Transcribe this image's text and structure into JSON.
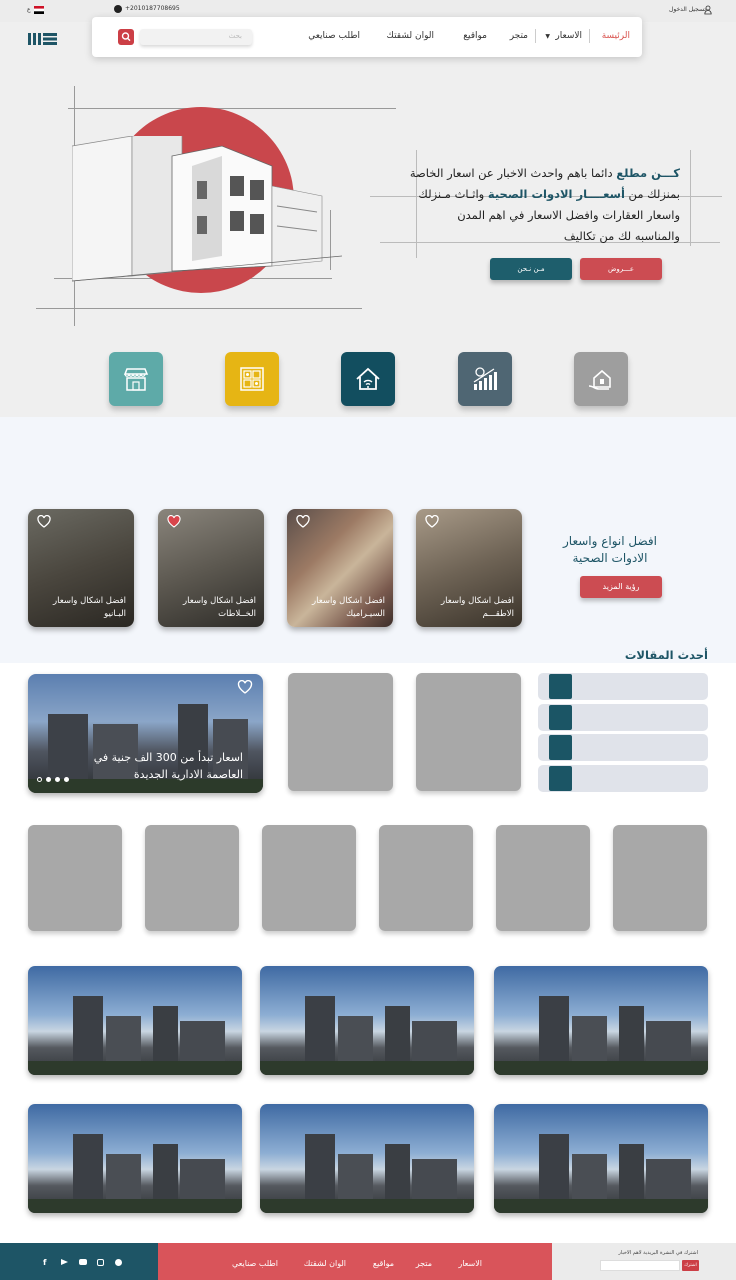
{
  "topbar": {
    "login_label": "تسجيل الدخول",
    "phone": "+2010187708695",
    "language": "ع"
  },
  "nav": {
    "items": [
      {
        "label": "الرئيسة",
        "active": true
      },
      {
        "label": "الاسعار",
        "dropdown": true
      },
      {
        "label": "متجر"
      },
      {
        "label": "مواقيع"
      },
      {
        "label": "الوان لشقتك"
      },
      {
        "label": "اطلب صنايعي"
      }
    ],
    "search_placeholder": "بحث"
  },
  "hero": {
    "line1_bold": "كـــن مطلع",
    "line1_rest": " دائما باهم واحدث الاخبار عن اسعار الخاصة",
    "line2_a": "بمنزلك من ",
    "line2_bold": "أسعــــار الادوات الصحية",
    "line2_b": " واثـاث مـنزلك",
    "line3": "واسعار العقارات وافضل الاسعار في اهم المدن",
    "line4": "والمناسبه لك من تكاليف",
    "btn_offers": "عـــروض",
    "btn_about": "مـن نـحن"
  },
  "categories": [
    {
      "icon": "house-hand-icon",
      "color": "#9e9e9e"
    },
    {
      "icon": "growth-chart-icon",
      "color": "#4f6673"
    },
    {
      "icon": "smart-home-icon",
      "color": "#124e5f"
    },
    {
      "icon": "tiles-icon",
      "color": "#e6b514"
    },
    {
      "icon": "store-icon",
      "color": "#5eaaa8"
    }
  ],
  "products": {
    "title_line1": "افضل انواع واسعار",
    "title_line2": "الادوات الصحية",
    "more_button": "رؤية المزيد",
    "items": [
      {
        "line1": "افضل اشكال واسعار",
        "line2": "الاطقـــم",
        "favorite": false
      },
      {
        "line1": "افضل اشكال واسعار",
        "line2": "السيـراميك",
        "favorite": false
      },
      {
        "line1": "افضل اشكال واسعار",
        "line2": "الخــلاطات",
        "favorite": true
      },
      {
        "line1": "افضل اشكال واسعار",
        "line2": "البـانيو",
        "favorite": false
      }
    ]
  },
  "articles": {
    "title": "أحدث المقالات",
    "feature_line1": "اسعار تبدأ من 300 الف جنية في",
    "feature_line2": "العاصمة الادارية الجديدة",
    "slides": 4
  },
  "footer": {
    "nav": [
      "الاسعار",
      "متجر",
      "مواقيع",
      "الوان لشقتك",
      "اطلب صنايعي"
    ],
    "subscribe_text": "اشترك في النشرة البريدية لاهم الاخبار",
    "subscribe_button": "اشترك"
  },
  "colors": {
    "accent_red": "#cc4c52",
    "brand_teal": "#1e5566"
  }
}
